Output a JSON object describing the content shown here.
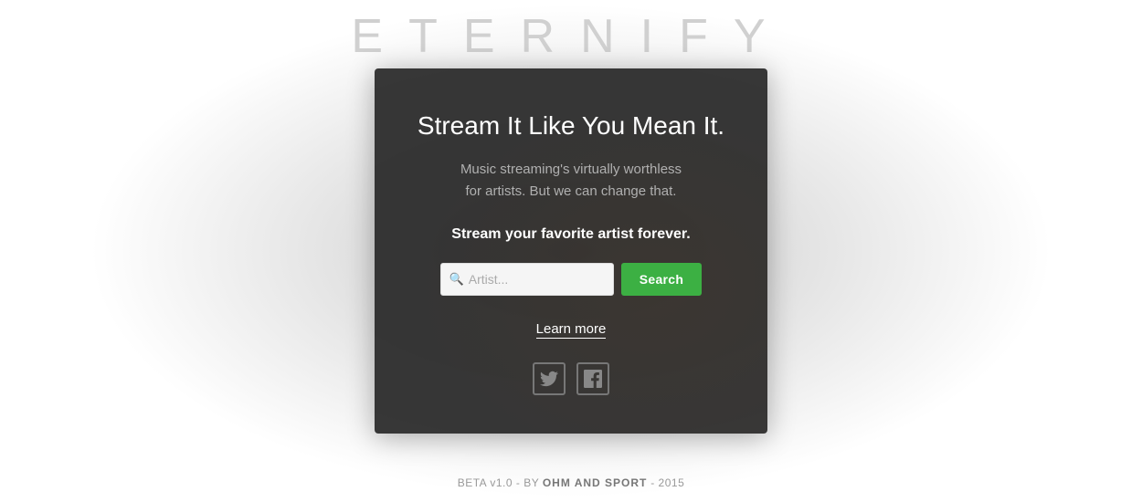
{
  "site": {
    "title": "ETERNIFY",
    "footer": {
      "text_prefix": "BETA v1.0 - BY ",
      "company": "OHM AND SPORT",
      "text_suffix": " - 2015"
    }
  },
  "card": {
    "headline": "Stream It Like You Mean It.",
    "subtext_line1": "Music streaming's virtually worthless",
    "subtext_line2": "for artists. But we can change that.",
    "stream_cta": "Stream your favorite artist forever.",
    "search": {
      "placeholder": "Artist...",
      "button_label": "Search"
    },
    "learn_more_label": "Learn more"
  },
  "social": {
    "twitter_label": "Twitter",
    "facebook_label": "Facebook"
  }
}
